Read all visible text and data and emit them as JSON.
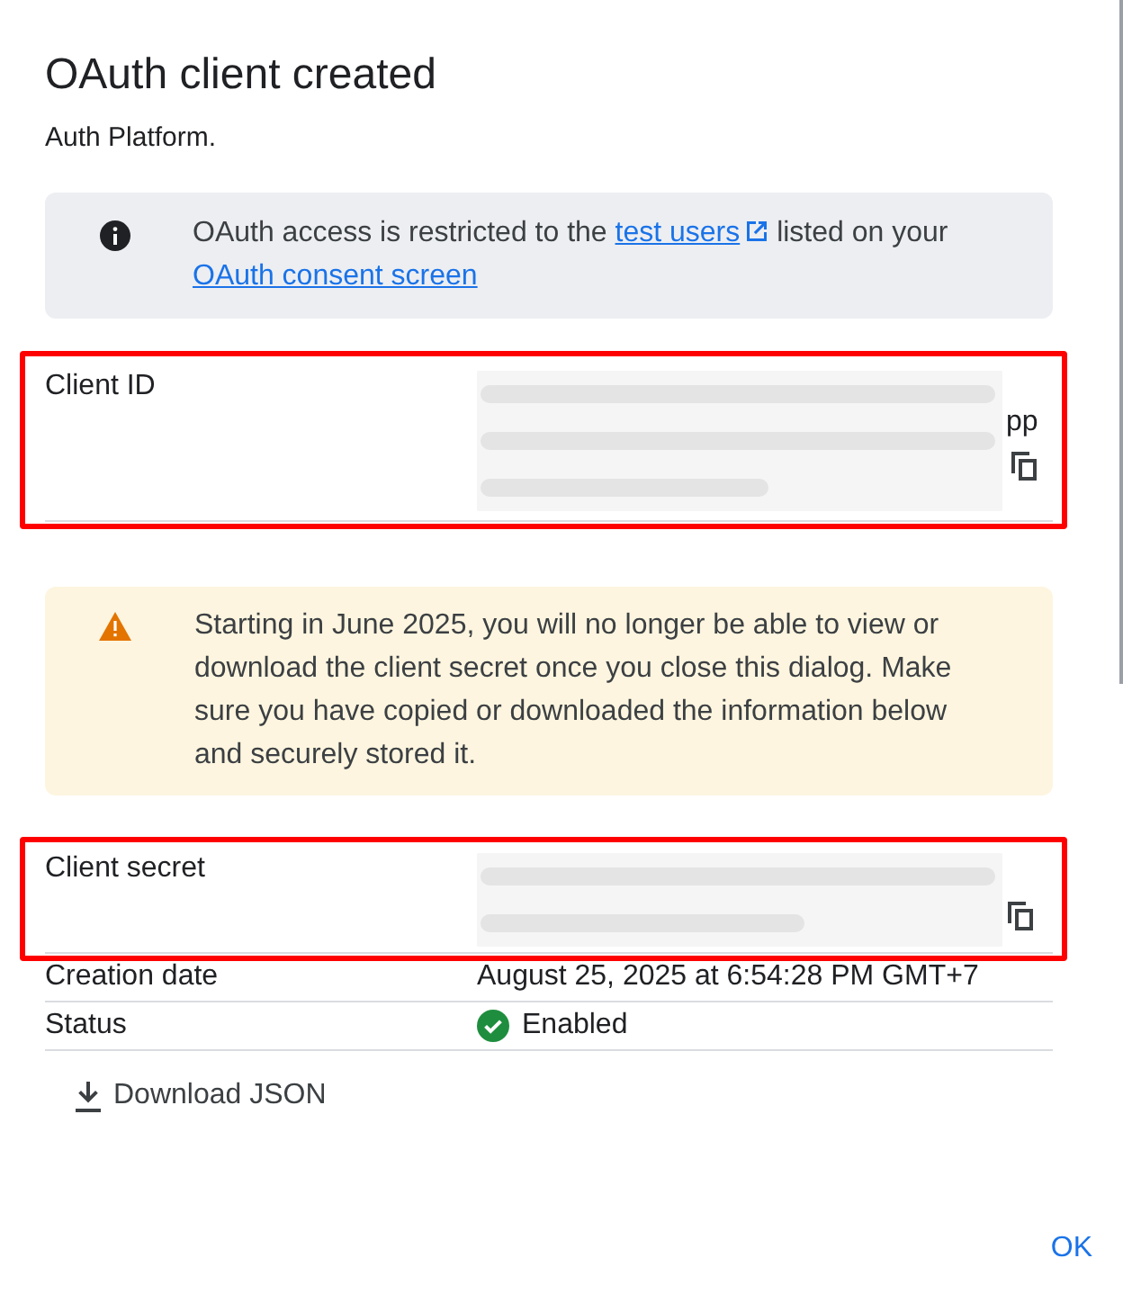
{
  "dialog": {
    "title": "OAuth client created",
    "subtitle": "Auth Platform."
  },
  "info_notice": {
    "kind": "info",
    "parts": [
      {
        "kind": "text",
        "text": "OAuth access is restricted to the "
      },
      {
        "kind": "link",
        "text": "test users",
        "external": true
      },
      {
        "kind": "text",
        "text": " listed on your "
      },
      {
        "kind": "link",
        "text": "OAuth consent screen",
        "external": false
      }
    ]
  },
  "client_id": {
    "label": "Client ID",
    "redacted": true,
    "visible_tail": "pp",
    "highlighted": true
  },
  "warning_notice": {
    "kind": "warning",
    "text": "Starting in June 2025, you will no longer be able to view or download the client secret once you close this dialog. Make sure you have copied or downloaded the information below and securely stored it."
  },
  "details": [
    {
      "kind": "secret",
      "label": "Client secret",
      "redacted": true,
      "highlighted": true
    },
    {
      "kind": "text",
      "label": "Creation date",
      "value": "August 25, 2025 at 6:54:28 PM GMT+7"
    },
    {
      "kind": "status",
      "label": "Status",
      "value": "Enabled",
      "enabled": true
    }
  ],
  "download_button": "Download JSON",
  "ok_button": "OK"
}
